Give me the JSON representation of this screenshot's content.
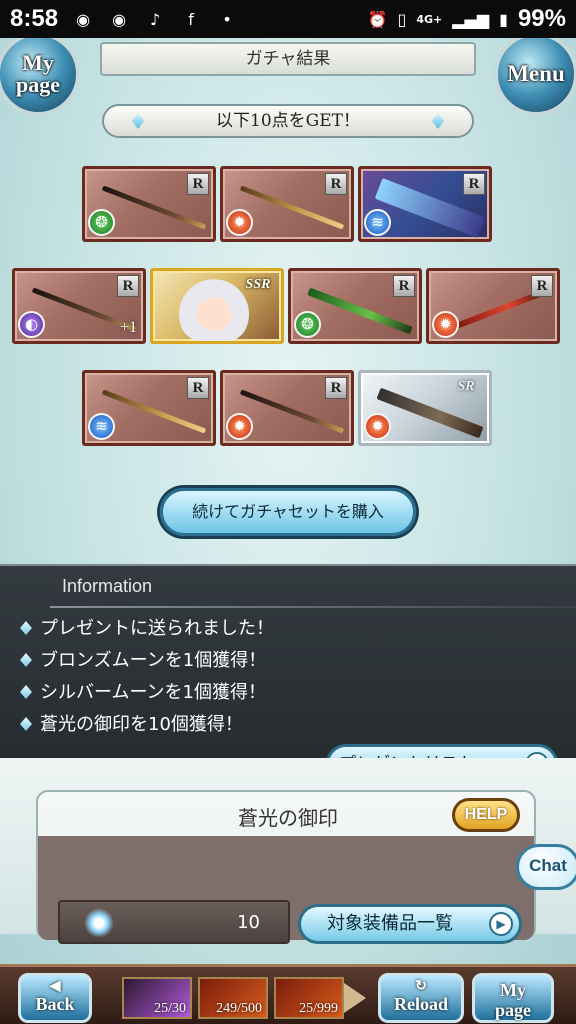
{
  "status_bar": {
    "time": "8:58",
    "notification_icons": [
      "discord-icon",
      "discord-icon",
      "music-icon",
      "facebook-icon",
      "dot-icon"
    ],
    "right_icons": [
      "alarm-icon",
      "vibrate-icon",
      "4g-icon",
      "signal-icon",
      "battery-icon"
    ],
    "network": "4G+",
    "battery": "99%"
  },
  "header": {
    "title": "ガチャ結果",
    "left_button": "My page",
    "left_button_line1": "My",
    "left_button_line2": "page",
    "right_button": "Menu"
  },
  "result": {
    "get_label": "以下10点をGET！",
    "items": [
      {
        "rarity": "R",
        "element": "wind",
        "kind": "polearm",
        "plus": ""
      },
      {
        "rarity": "R",
        "element": "fire",
        "kind": "spear",
        "plus": ""
      },
      {
        "rarity": "R",
        "element": "water",
        "kind": "summon",
        "plus": ""
      },
      {
        "rarity": "R",
        "element": "dark",
        "kind": "sword",
        "plus": "+1"
      },
      {
        "rarity": "SSR",
        "element": "",
        "kind": "character",
        "plus": ""
      },
      {
        "rarity": "R",
        "element": "wind",
        "kind": "blade",
        "plus": ""
      },
      {
        "rarity": "R",
        "element": "fire",
        "kind": "staff",
        "plus": ""
      },
      {
        "rarity": "R",
        "element": "water",
        "kind": "sword",
        "plus": ""
      },
      {
        "rarity": "R",
        "element": "fire",
        "kind": "spear",
        "plus": ""
      },
      {
        "rarity": "SR",
        "element": "fire",
        "kind": "gun",
        "plus": ""
      }
    ],
    "buy_button": "続けてガチャセットを購入"
  },
  "information": {
    "title": "Information",
    "lines": [
      "プレゼントに送られました！",
      "ブロンズムーンを1個獲得！",
      "シルバームーンを1個獲得！",
      "蒼光の御印を10個獲得！"
    ],
    "present_button": "プレゼントリストへ"
  },
  "seal": {
    "title": "蒼光の御印",
    "count": "10",
    "list_button": "対象装備品一覧",
    "help_button": "HELP",
    "chat_button": "Chat"
  },
  "nav": {
    "back": "Back",
    "reload": "Reload",
    "mypage_line1": "My",
    "mypage_line2": "page",
    "items": [
      "25/30",
      "249/500",
      "25/999"
    ]
  }
}
